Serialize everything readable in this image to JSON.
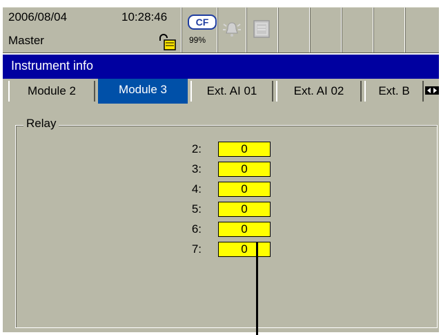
{
  "status": {
    "date": "2006/08/04",
    "time": "10:28:46",
    "user": "Master",
    "cf_label": "CF",
    "cf_usage": "99%"
  },
  "window_title": "Instrument info",
  "tabs": [
    {
      "label": "Module 2",
      "active": false
    },
    {
      "label": "Module 3",
      "active": true
    },
    {
      "label": "Ext. AI 01",
      "active": false
    },
    {
      "label": "Ext. AI 02",
      "active": false
    },
    {
      "label": "Ext. B",
      "active": false
    }
  ],
  "group": {
    "title": "Relay",
    "rows": [
      {
        "label": "2:",
        "value": "0"
      },
      {
        "label": "3:",
        "value": "0"
      },
      {
        "label": "4:",
        "value": "0"
      },
      {
        "label": "5:",
        "value": "0"
      },
      {
        "label": "6:",
        "value": "0"
      },
      {
        "label": "7:",
        "value": "0"
      }
    ]
  },
  "colors": {
    "titlebar": "#0000a0",
    "active_tab": "#0050a8",
    "background": "#b9b9a8",
    "value_field": "#ffff00"
  },
  "icons": [
    "lock-icon",
    "cf-card-icon",
    "alarm-bell-icon",
    "display-icon",
    "tab-scroll-arrows-icon"
  ]
}
